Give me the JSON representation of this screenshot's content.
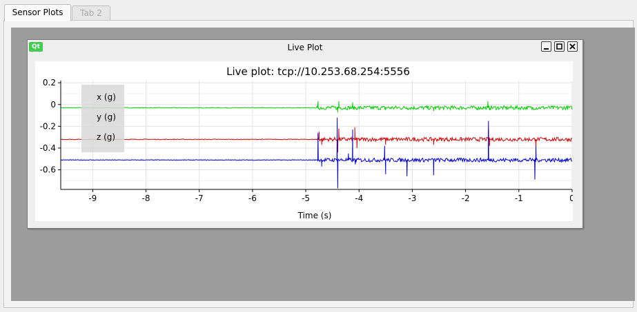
{
  "tabs": [
    {
      "label": "Sensor Plots",
      "active": true
    },
    {
      "label": "Tab 2",
      "active": false
    }
  ],
  "window": {
    "logo_text": "Qt",
    "title": "Live Plot",
    "controls": [
      "minimize-icon",
      "maximize-icon",
      "close-icon"
    ]
  },
  "colors": {
    "x": "#00cc00",
    "y": "#cc0000",
    "z": "#0000cc",
    "mdi_background": "#9c9c9c"
  },
  "chart_data": {
    "type": "line",
    "title": "Live plot: tcp://10.253.68.254:5556",
    "xlabel": "Time (s)",
    "ylabel": "",
    "xlim": [
      -9.6,
      0
    ],
    "ylim": [
      -0.78,
      0.22
    ],
    "xticks": [
      -9,
      -8,
      -7,
      -6,
      -5,
      -4,
      -3,
      -2,
      -1,
      0
    ],
    "yticks": [
      0.2,
      0,
      -0.2,
      -0.4,
      -0.6
    ],
    "xtick_labels": [
      "-9",
      "-8",
      "-7",
      "-6",
      "-5",
      "-4",
      "-3",
      "-2",
      "-1",
      "0"
    ],
    "ytick_labels": [
      "0.2",
      "0",
      "-0.2",
      "-0.4",
      "-0.6"
    ],
    "grid": true,
    "legend_position": "left",
    "series": [
      {
        "name": "x (g)",
        "color": "#00cc00",
        "baseline": -0.03,
        "events": [
          [
            -4.77,
            0.03
          ],
          [
            -4.72,
            -0.03
          ],
          [
            -4.4,
            -0.07
          ],
          [
            -4.38,
            0.03
          ],
          [
            -4.12,
            0.02
          ],
          [
            -3.5,
            -0.05
          ],
          [
            -3.1,
            -0.04
          ],
          [
            -2.6,
            -0.06
          ],
          [
            -1.58,
            0.03
          ],
          [
            -1.55,
            -0.05
          ],
          [
            -0.75,
            -0.05
          ]
        ]
      },
      {
        "name": "y (g)",
        "color": "#cc0000",
        "baseline": -0.32,
        "events": [
          [
            -4.75,
            -0.25
          ],
          [
            -4.7,
            -0.37
          ],
          [
            -4.4,
            -0.44
          ],
          [
            -4.38,
            -0.22
          ],
          [
            -4.08,
            -0.21
          ],
          [
            -4.04,
            -0.4
          ],
          [
            -3.5,
            -0.37
          ],
          [
            -2.6,
            -0.37
          ],
          [
            -1.57,
            -0.22
          ],
          [
            -1.55,
            -0.38
          ],
          [
            -0.68,
            -0.4
          ]
        ]
      },
      {
        "name": "z (g)",
        "color": "#0000cc",
        "baseline": -0.51,
        "events": [
          [
            -4.77,
            -0.26
          ],
          [
            -4.7,
            -0.57
          ],
          [
            -4.4,
            -0.77
          ],
          [
            -4.41,
            -0.12
          ],
          [
            -4.2,
            -0.45
          ],
          [
            -4.12,
            -0.23
          ],
          [
            -4.07,
            -0.55
          ],
          [
            -3.5,
            -0.64
          ],
          [
            -3.52,
            -0.38
          ],
          [
            -3.1,
            -0.66
          ],
          [
            -2.6,
            -0.65
          ],
          [
            -1.57,
            -0.15
          ],
          [
            -1.55,
            -0.52
          ],
          [
            -0.7,
            -0.69
          ],
          [
            -0.68,
            -0.38
          ]
        ]
      }
    ]
  }
}
